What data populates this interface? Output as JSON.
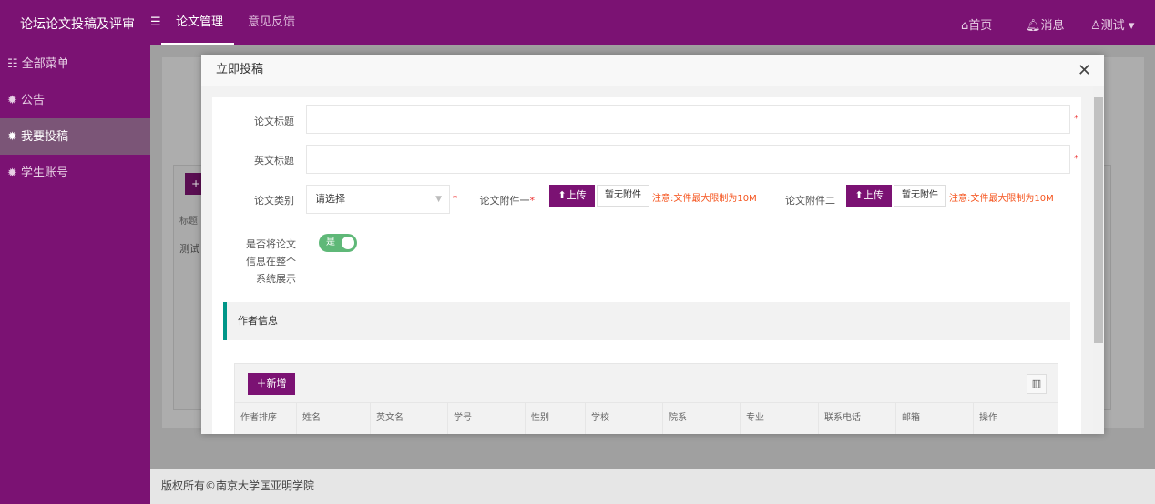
{
  "header": {
    "logo": "论坛论文投稿及评审",
    "nav": [
      "论文管理",
      "意见反馈"
    ],
    "home": "首页",
    "messages": "消息",
    "user": "测试"
  },
  "sidebar": {
    "items": [
      {
        "label": "全部菜单",
        "icon": "grid-icon"
      },
      {
        "label": "公告",
        "icon": "gear-icon"
      },
      {
        "label": "我要投稿",
        "icon": "gear-icon",
        "active": true
      },
      {
        "label": "学生账号",
        "icon": "gear-icon"
      }
    ]
  },
  "background": {
    "col_title": "标题",
    "row_value": "测试"
  },
  "footer": "版权所有©南京大学匡亚明学院",
  "modal": {
    "title": "立即投稿",
    "form": {
      "title_label": "论文标题",
      "title_value": "",
      "en_title_label": "英文标题",
      "en_title_value": "",
      "category_label": "论文类别",
      "category_value": "请选择",
      "attach1_label": "论文附件一",
      "attach2_label": "论文附件二",
      "upload_label": "上传",
      "no_attach_label": "暂无附件",
      "size_note": "注意:文件最大限制为10M",
      "display_label": "是否将论文信息在整个系统展示",
      "display_toggle": "是",
      "display_on": true,
      "required_mark": "*"
    },
    "author_section": "作者信息",
    "author_table": {
      "add_label": "新增",
      "columns": [
        "作者排序",
        "姓名",
        "英文名",
        "学号",
        "性别",
        "学校",
        "院系",
        "专业",
        "联系电话",
        "邮箱",
        "操作"
      ]
    }
  },
  "colors": {
    "brand": "#7b1273",
    "accent": "#009688",
    "toggle": "#5fb878",
    "warning": "#f5541e"
  }
}
